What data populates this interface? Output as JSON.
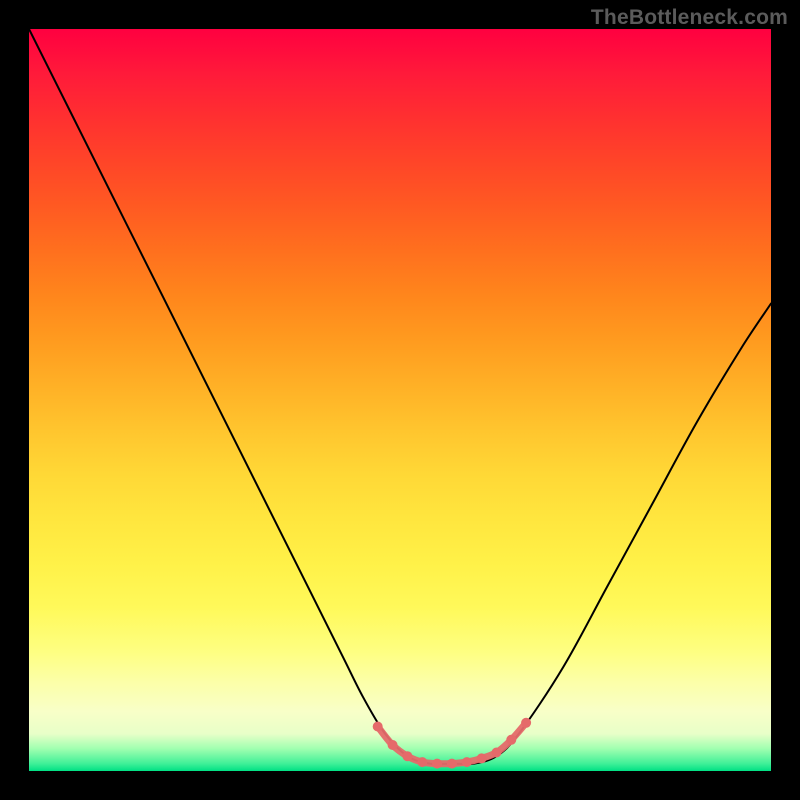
{
  "watermark": "TheBottleneck.com",
  "colors": {
    "curve": "#000000",
    "marker": "#e56a6a",
    "gradient_top": "#ff0040",
    "gradient_bottom": "#00e084"
  },
  "chart_data": {
    "type": "line",
    "title": "",
    "xlabel": "",
    "ylabel": "",
    "xlim": [
      0,
      100
    ],
    "ylim": [
      0,
      100
    ],
    "series": [
      {
        "name": "bottleneck-curve",
        "x": [
          0,
          6,
          12,
          18,
          24,
          30,
          36,
          42,
          45,
          48,
          51,
          54,
          57,
          60,
          63,
          66,
          72,
          78,
          84,
          90,
          96,
          100
        ],
        "y": [
          100,
          88,
          76,
          64,
          52,
          40,
          28,
          16,
          10,
          5,
          2,
          1,
          1,
          1,
          2,
          5,
          14,
          25,
          36,
          47,
          57,
          63
        ]
      }
    ],
    "markers": {
      "name": "valley-dots",
      "color": "#e56a6a",
      "radius": 5,
      "points": [
        {
          "x": 47,
          "y": 6.0
        },
        {
          "x": 49,
          "y": 3.5
        },
        {
          "x": 51,
          "y": 2.0
        },
        {
          "x": 53,
          "y": 1.2
        },
        {
          "x": 55,
          "y": 1.0
        },
        {
          "x": 57,
          "y": 1.0
        },
        {
          "x": 59,
          "y": 1.2
        },
        {
          "x": 61,
          "y": 1.7
        },
        {
          "x": 63,
          "y": 2.5
        },
        {
          "x": 65,
          "y": 4.2
        },
        {
          "x": 67,
          "y": 6.5
        }
      ]
    }
  }
}
